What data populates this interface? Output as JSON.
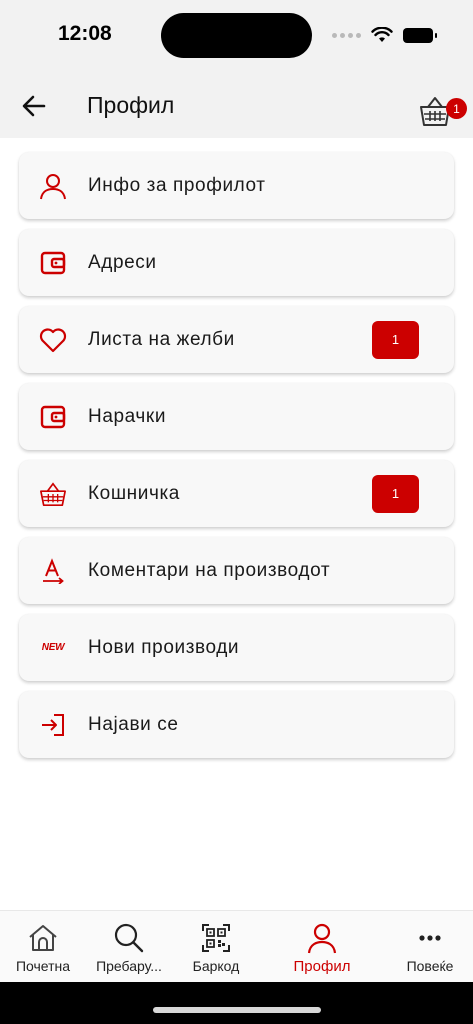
{
  "status_bar": {
    "time": "12:08"
  },
  "header": {
    "title": "Профил",
    "cart_count": "1"
  },
  "menu": [
    {
      "label": "Инфо за профилот",
      "icon": "user-icon",
      "badge": null
    },
    {
      "label": "Адреси",
      "icon": "wallet-icon",
      "badge": null
    },
    {
      "label": "Листа на желби",
      "icon": "heart-icon",
      "badge": "1"
    },
    {
      "label": "Нарачки",
      "icon": "wallet-icon",
      "badge": null
    },
    {
      "label": "Кошничка",
      "icon": "basket-icon",
      "badge": "1"
    },
    {
      "label": "Коментари на производот",
      "icon": "review-icon",
      "badge": null
    },
    {
      "label": "Нови производи",
      "icon": "new-icon",
      "badge": null
    },
    {
      "label": "Најави се",
      "icon": "login-icon",
      "badge": null
    }
  ],
  "new_icon_text": "NEW",
  "bottom_nav": [
    {
      "label": "Почетна",
      "icon": "home-icon"
    },
    {
      "label": "Пребару...",
      "icon": "search-icon"
    },
    {
      "label": "Баркод",
      "icon": "qr-icon"
    },
    {
      "label": "Профил",
      "icon": "user-icon",
      "active": true
    },
    {
      "label": "Повеќе",
      "icon": "more-icon"
    }
  ],
  "colors": {
    "accent": "#cc0000",
    "header_bg": "#f2f2f2",
    "card_bg": "#f8f8f8"
  }
}
